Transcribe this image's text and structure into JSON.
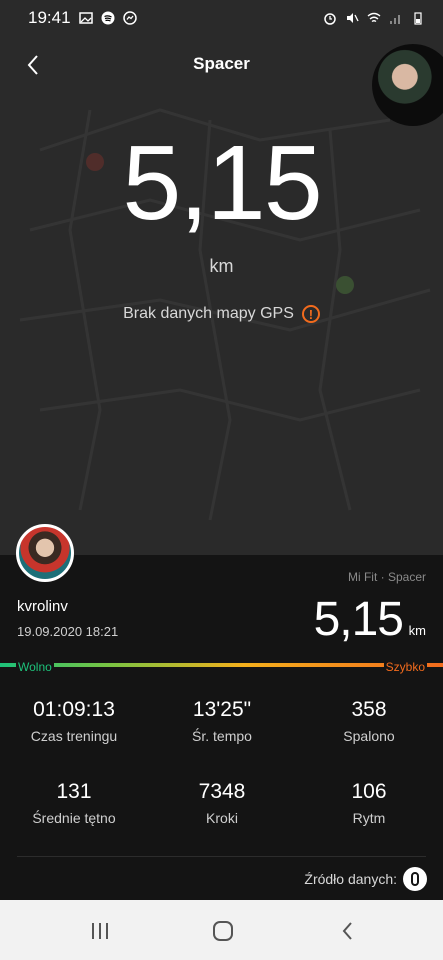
{
  "status": {
    "time": "19:41"
  },
  "header": {
    "title": "Spacer"
  },
  "hero": {
    "distance": "5,15",
    "unit": "km",
    "gps_message": "Brak danych mapy GPS",
    "gps_warn_glyph": "!"
  },
  "summary": {
    "source_label": "Mi Fit · Spacer",
    "username": "kvrolinv",
    "datetime": "19.09.2020 18:21",
    "distance": "5,15",
    "unit": "km"
  },
  "speed": {
    "slow": "Wolno",
    "fast": "Szybko"
  },
  "stats": [
    {
      "value": "01:09:13",
      "label": "Czas treningu"
    },
    {
      "value": "13'25\"",
      "label": "Śr. tempo"
    },
    {
      "value": "358",
      "label": "Spalono"
    },
    {
      "value": "131",
      "label": "Średnie tętno"
    },
    {
      "value": "7348",
      "label": "Kroki"
    },
    {
      "value": "106",
      "label": "Rytm"
    }
  ],
  "data_source": {
    "label": "Źródło danych:"
  },
  "colors": {
    "accent_orange": "#f26b1d",
    "accent_green": "#1dc27a",
    "card_bg": "#141414",
    "map_bg": "#2a2a2a"
  }
}
